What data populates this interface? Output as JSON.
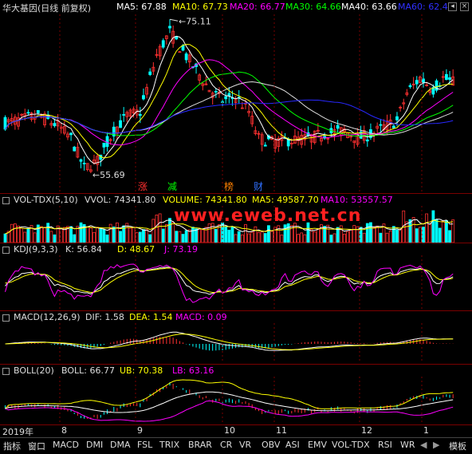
{
  "header": {
    "title": "华大基因(日线 前复权)",
    "ma5": "MA5: 67.88",
    "ma10": "MA10: 67.73",
    "ma20": "MA20: 66.77",
    "ma30": "MA30: 64.66",
    "ma40": "MA40: 63.66",
    "ma60": "MA60: 62.4"
  },
  "colors": {
    "ma5": "#ffffff",
    "ma10": "#ffff00",
    "ma20": "#ff00ff",
    "ma30": "#00ff00",
    "ma40": "#ffffff",
    "ma60": "#0000ff",
    "up": "#ff3030",
    "down": "#00ffff",
    "dea": "#ffff00",
    "frame": "#7a0000"
  },
  "price": {
    "high_label": "75.11",
    "low_label": "55.69"
  },
  "events": [
    "涨",
    "减",
    "榜",
    "财"
  ],
  "vol": {
    "name": "VOL-TDX(5,10)",
    "vvol": "VVOL: 74341.80",
    "volume": "VOLUME: 74341.80",
    "ma5": "MA5: 49587.70",
    "ma10": "MA10: 53557.57"
  },
  "kdj": {
    "name": "KDJ(9,3,3)",
    "k": "K: 56.84",
    "d": "D: 48.67",
    "j": "J: 73.19"
  },
  "macd": {
    "name": "MACD(12,26,9)",
    "dif": "DIF: 1.58",
    "dea": "DEA: 1.54",
    "macd": "MACD: 0.09"
  },
  "boll": {
    "name": "BOLL(20)",
    "boll": "BOLL: 66.77",
    "ub": "UB: 70.38",
    "lb": "LB: 63.16"
  },
  "watermark": "www.eweb.net.cn",
  "date_axis": [
    "2019年",
    "8",
    "9",
    "10",
    "11",
    "12",
    "1"
  ],
  "tabs": [
    "指标",
    "窗口",
    "MACD",
    "DMI",
    "DMA",
    "FSL",
    "TRIX",
    "BRAR",
    "CR",
    "VR",
    "OBV",
    "ASI",
    "EMV",
    "VOL-TDX",
    "RSI",
    "WR",
    "模板"
  ]
}
